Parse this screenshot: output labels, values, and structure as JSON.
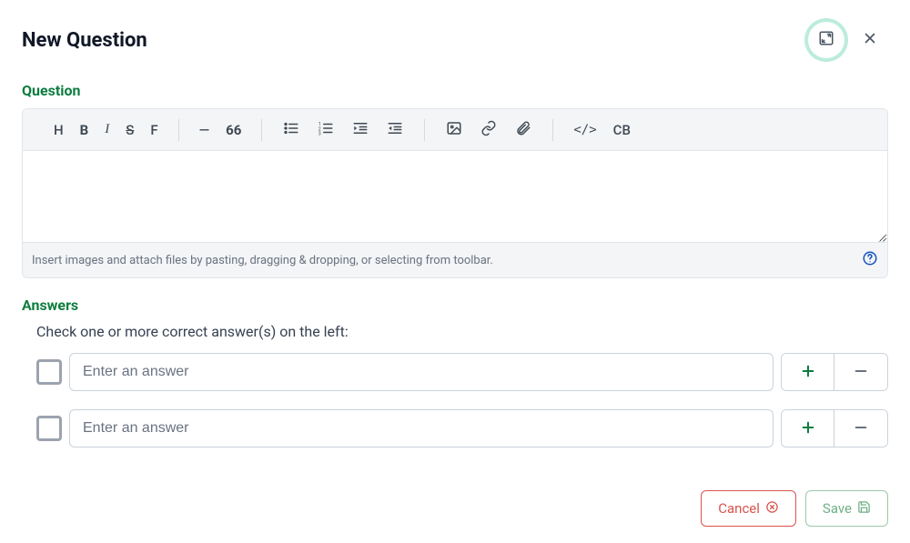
{
  "header": {
    "title": "New Question"
  },
  "sections": {
    "question_label": "Question",
    "answers_label": "Answers"
  },
  "toolbar": {
    "heading": "H",
    "bold": "B",
    "italic": "I",
    "strike": "S",
    "font": "F",
    "hr": "—",
    "quote": "66",
    "code": "</>",
    "codeblock": "CB"
  },
  "editor": {
    "content": "",
    "footer_hint": "Insert images and attach files by pasting, dragging & dropping, or selecting from toolbar."
  },
  "answers": {
    "instruction": "Check one or more correct answer(s) on the left:",
    "rows": [
      {
        "placeholder": "Enter an answer",
        "value": ""
      },
      {
        "placeholder": "Enter an answer",
        "value": ""
      }
    ]
  },
  "actions": {
    "cancel": "Cancel",
    "save": "Save"
  },
  "icons": {
    "expand": "expand-icon",
    "close": "close-icon",
    "help": "help-icon",
    "plus": "plus-icon",
    "minus": "minus-icon",
    "bullet_list": "bullet-list-icon",
    "ordered_list": "ordered-list-icon",
    "indent": "indent-icon",
    "outdent": "outdent-icon",
    "image": "image-icon",
    "link": "link-icon",
    "attachment": "attachment-icon",
    "cancel_badge": "cancel-circle-icon",
    "save_badge": "save-disk-icon"
  },
  "colors": {
    "accent": "#0d7d3f",
    "danger": "#d9534f",
    "muted": "#6b7280"
  }
}
